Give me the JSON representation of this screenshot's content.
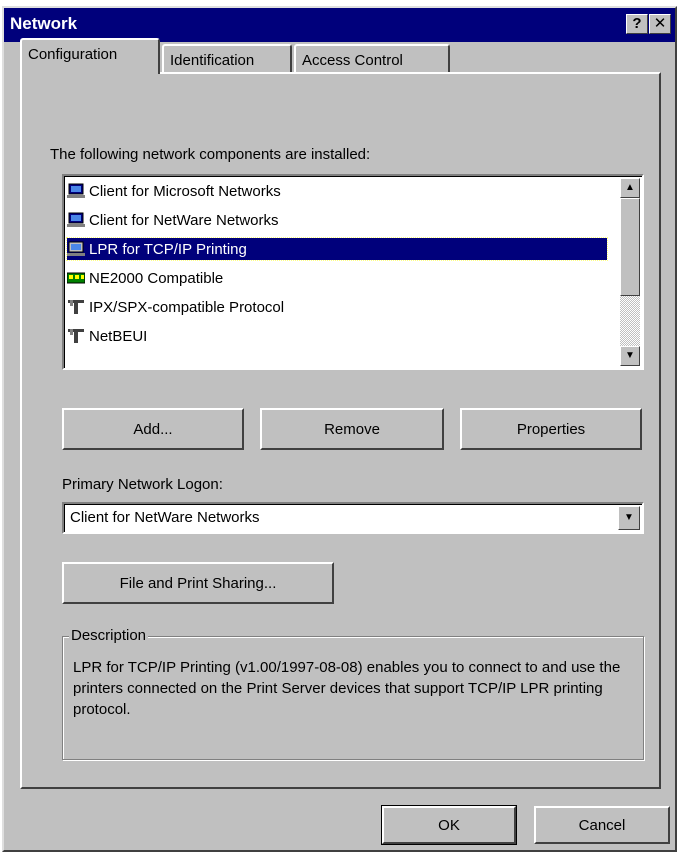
{
  "window": {
    "title": "Network",
    "help_glyph": "?",
    "close_glyph": "✕"
  },
  "tabs": [
    {
      "label": "Configuration",
      "active": true
    },
    {
      "label": "Identification",
      "active": false
    },
    {
      "label": "Access Control",
      "active": false
    }
  ],
  "components": {
    "label": "The following network components are installed:",
    "items": [
      {
        "label": "Client for Microsoft Networks",
        "icon": "network-client-icon",
        "selected": false
      },
      {
        "label": "Client for NetWare Networks",
        "icon": "network-client-icon",
        "selected": false
      },
      {
        "label": "LPR for TCP/IP Printing",
        "icon": "network-client-icon",
        "selected": true
      },
      {
        "label": "NE2000 Compatible",
        "icon": "network-adapter-icon",
        "selected": false
      },
      {
        "label": "IPX/SPX-compatible Protocol",
        "icon": "protocol-icon",
        "selected": false
      },
      {
        "label": "NetBEUI",
        "icon": "protocol-icon",
        "selected": false
      }
    ]
  },
  "buttons": {
    "add": "Add...",
    "remove": "Remove",
    "properties": "Properties",
    "file_print_sharing": "File and Print Sharing...",
    "ok": "OK",
    "cancel": "Cancel"
  },
  "logon": {
    "label": "Primary Network Logon:",
    "value": "Client for NetWare Networks"
  },
  "description": {
    "legend": "Description",
    "text": "LPR for TCP/IP Printing (v1.00/1997-08-08) enables you to connect to and use the printers connected on the Print Server devices that support TCP/IP LPR printing protocol."
  },
  "colors": {
    "titlebar": "#00007b",
    "face": "#c0c0c0",
    "selection": "#00007b"
  }
}
